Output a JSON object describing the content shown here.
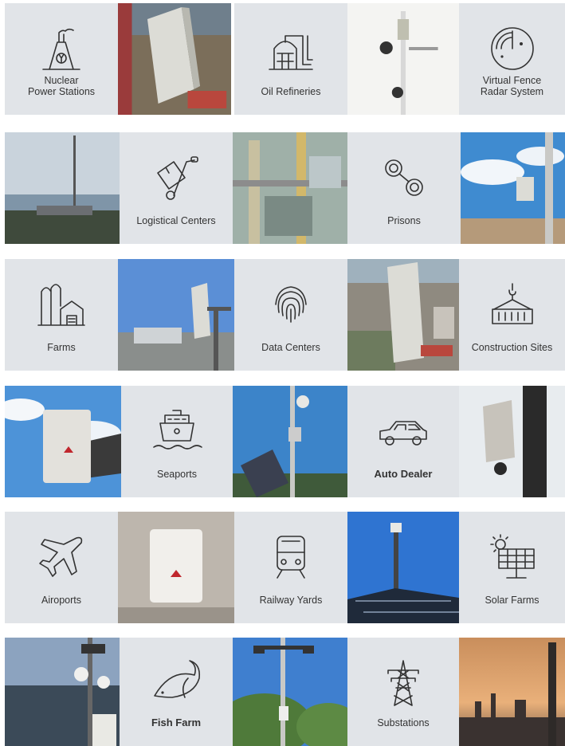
{
  "tiles": [
    {
      "label": "Nuclear\nPower Stations",
      "icon": "nuclear-plant-icon"
    },
    {
      "label": "Oil Refineries",
      "icon": "oil-refinery-icon"
    },
    {
      "label": "Virtual Fence\nRadar System",
      "icon": "radar-icon"
    },
    {
      "label": "Logistical Centers",
      "icon": "hand-truck-icon"
    },
    {
      "label": "Prisons",
      "icon": "handcuffs-icon"
    },
    {
      "label": "Farms",
      "icon": "barn-silo-icon"
    },
    {
      "label": "Data Centers",
      "icon": "fingerprint-icon"
    },
    {
      "label": "Construction Sites",
      "icon": "crane-container-icon"
    },
    {
      "label": "Seaports",
      "icon": "ship-icon"
    },
    {
      "label": "Auto Dealer",
      "icon": "car-icon"
    },
    {
      "label": "Airoports",
      "icon": "airplane-icon"
    },
    {
      "label": "Railway Yards",
      "icon": "train-icon"
    },
    {
      "label": "Solar Farms",
      "icon": "solar-panel-icon"
    },
    {
      "label": "Fish Farm",
      "icon": "fish-icon"
    },
    {
      "label": "Substations",
      "icon": "power-tower-icon"
    }
  ],
  "colors": {
    "tile_bg": "#e1e4e8",
    "icon_stroke": "#333333",
    "logo_red": "#c0262d"
  }
}
